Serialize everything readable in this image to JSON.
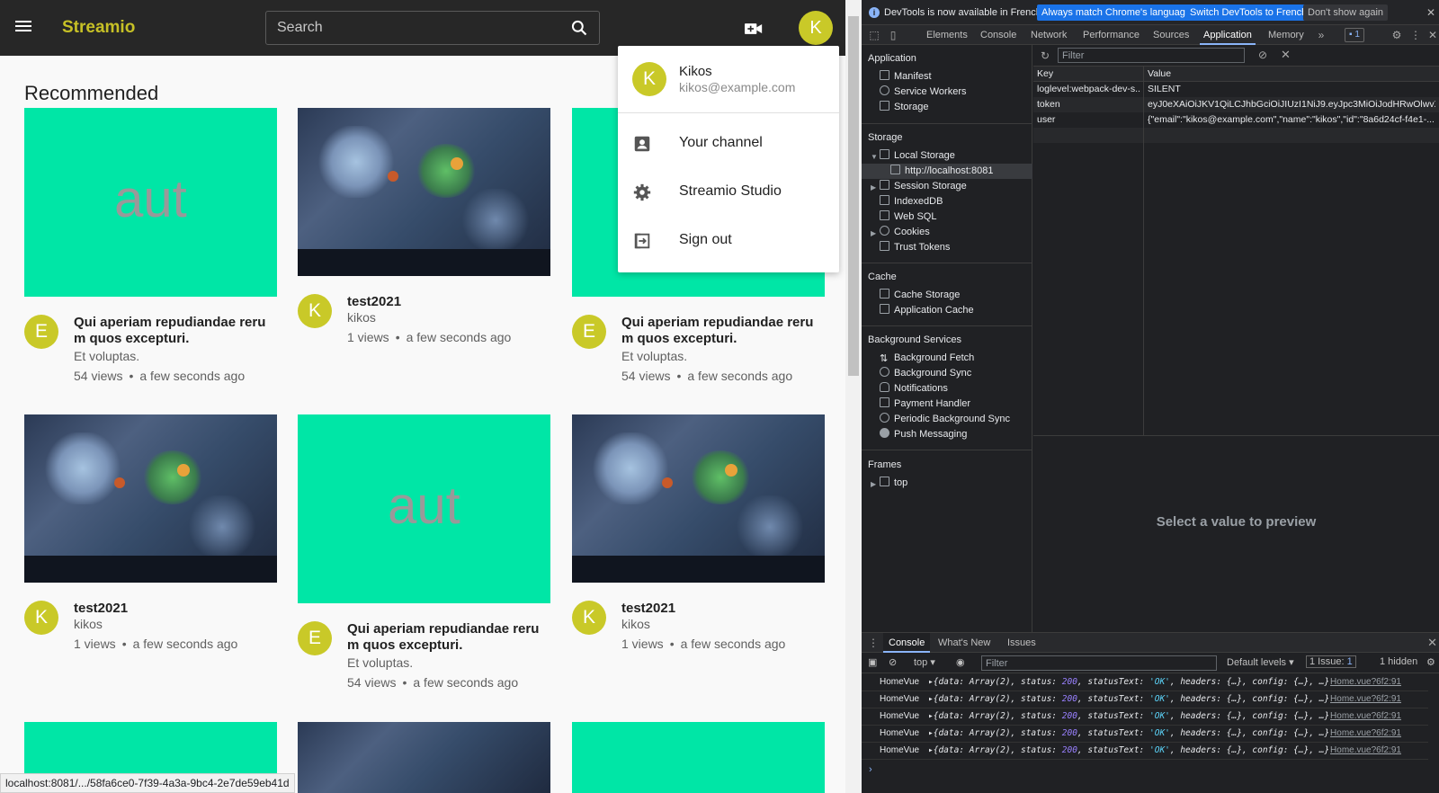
{
  "app": {
    "brand": "Streamio",
    "search_placeholder": "Search",
    "user_initial": "K",
    "section_title": "Recommended",
    "status_url": "localhost:8081/.../58fa6ce0-7f39-4a3a-9bc4-2e7de59eb41d",
    "videos": [
      {
        "thumb_type": "teal",
        "thumb_text": "aut",
        "avatar": "E",
        "title": "Qui aperiam repudiandae reru m quos excepturi.",
        "channel": "Et voluptas.",
        "views": "54 views",
        "age": "a few seconds ago"
      },
      {
        "thumb_type": "game",
        "thumb_text": "",
        "avatar": "K",
        "title": "test2021",
        "channel": "kikos",
        "views": "1 views",
        "age": "a few seconds ago"
      },
      {
        "thumb_type": "teal",
        "thumb_text": "",
        "avatar": "E",
        "title": "Qui aperiam repudiandae reru m quos excepturi.",
        "channel": "Et voluptas.",
        "views": "54 views",
        "age": "a few seconds ago"
      },
      {
        "thumb_type": "game",
        "thumb_text": "",
        "avatar": "K",
        "title": "test2021",
        "channel": "kikos",
        "views": "1 views",
        "age": "a few seconds ago"
      },
      {
        "thumb_type": "teal",
        "thumb_text": "aut",
        "avatar": "E",
        "title": "Qui aperiam repudiandae reru m quos excepturi.",
        "channel": "Et voluptas.",
        "views": "54 views",
        "age": "a few seconds ago"
      },
      {
        "thumb_type": "game",
        "thumb_text": "",
        "avatar": "K",
        "title": "test2021",
        "channel": "kikos",
        "views": "1 views",
        "age": "a few seconds ago"
      }
    ],
    "user_menu": {
      "name": "Kikos",
      "email": "kikos@example.com",
      "items": [
        {
          "label": "Your channel",
          "icon": "account-box-icon"
        },
        {
          "label": "Streamio Studio",
          "icon": "gear-icon"
        },
        {
          "label": "Sign out",
          "icon": "sign-out-icon"
        }
      ]
    }
  },
  "devtools": {
    "info_text": "DevTools is now available in French!",
    "btn_match": "Always match Chrome's language",
    "btn_switch": "Switch DevTools to French",
    "btn_dismiss": "Don't show again",
    "tabs": [
      "Elements",
      "Console",
      "Network",
      "Performance",
      "Sources",
      "Application",
      "Memory"
    ],
    "active_tab": "Application",
    "issues_count": "1",
    "sidebar": {
      "application_head": "Application",
      "application_items": [
        "Manifest",
        "Service Workers",
        "Storage"
      ],
      "storage_head": "Storage",
      "local_storage": "Local Storage",
      "local_origin": "http://localhost:8081",
      "storage_items": [
        "Session Storage",
        "IndexedDB",
        "Web SQL",
        "Cookies",
        "Trust Tokens"
      ],
      "cache_head": "Cache",
      "cache_items": [
        "Cache Storage",
        "Application Cache"
      ],
      "bg_head": "Background Services",
      "bg_items": [
        "Background Fetch",
        "Background Sync",
        "Notifications",
        "Payment Handler",
        "Periodic Background Sync",
        "Push Messaging"
      ],
      "frames_head": "Frames",
      "frames_item": "top"
    },
    "filter_placeholder": "Filter",
    "table": {
      "col_key": "Key",
      "col_value": "Value",
      "rows": [
        {
          "key": "loglevel:webpack-dev-s...",
          "value": "SILENT"
        },
        {
          "key": "token",
          "value": "eyJ0eXAiOiJKV1QiLCJhbGciOiJIUzI1NiJ9.eyJpc3MiOiJodHRwOlwvXC..."
        },
        {
          "key": "user",
          "value": "{\"email\":\"kikos@example.com\",\"name\":\"kikos\",\"id\":\"8a6d24cf-f4e1-..."
        }
      ]
    },
    "preview_text": "Select a value to preview",
    "drawer": {
      "tabs": [
        "Console",
        "What's New",
        "Issues"
      ],
      "context": "top",
      "filter_placeholder": "Filter",
      "levels": "Default levels",
      "issues": "1 Issue:",
      "issues_num": "1",
      "hidden": "1 hidden",
      "logs": [
        {
          "src": "HomeVue",
          "link": "Home.vue?6f2:91"
        },
        {
          "src": "HomeVue",
          "link": "Home.vue?6f2:91"
        },
        {
          "src": "HomeVue",
          "link": "Home.vue?6f2:91"
        },
        {
          "src": "HomeVue",
          "link": "Home.vue?6f2:91"
        },
        {
          "src": "HomeVue",
          "link": "Home.vue?6f2:91"
        }
      ],
      "log_msg_parts": {
        "open": "{data: ",
        "arr": "Array(2)",
        "mid1": ", status: ",
        "status": "200",
        "mid2": ", statusText: ",
        "text": "'OK'",
        "rest": ", headers: {…}, config: {…}, …}"
      }
    }
  },
  "colors": {
    "teal": "#00e6a6",
    "avatar": "#c9c928",
    "brand": "#c7c126",
    "devtools_accent": "#8ab4f8"
  }
}
